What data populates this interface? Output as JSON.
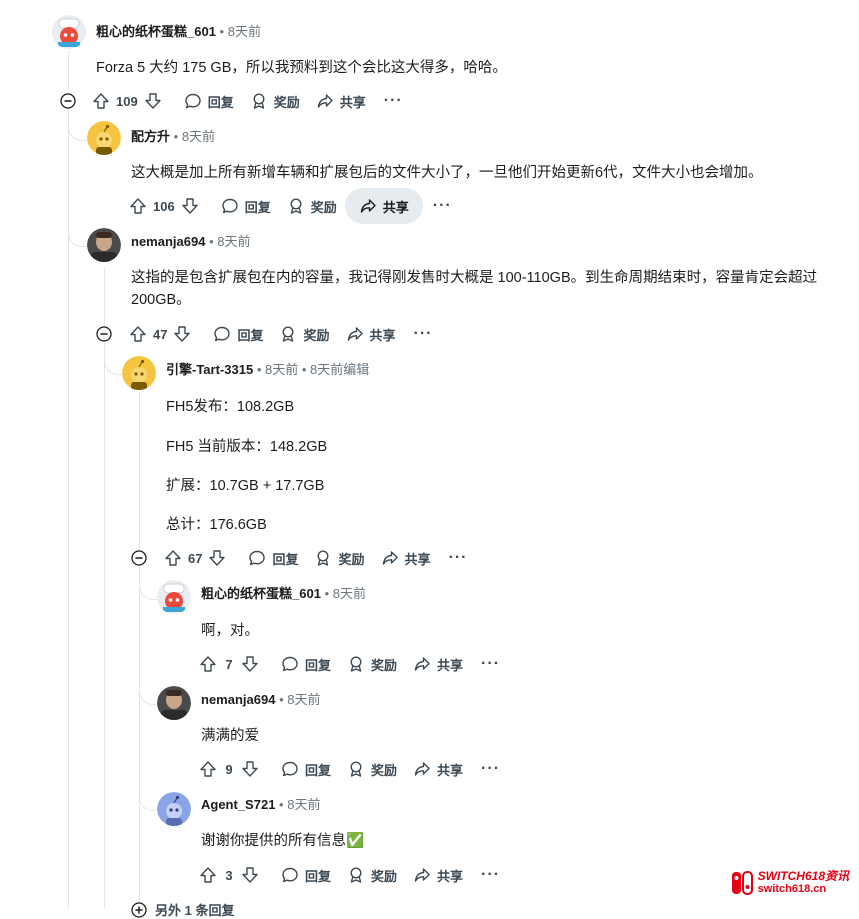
{
  "labels": {
    "reply": "回复",
    "award": "奖励",
    "share": "共享",
    "more": "···"
  },
  "comments": [
    {
      "user": "粗心的纸杯蛋糕_601",
      "time": "8天前",
      "text": "Forza 5 大约 175 GB，所以我预料到这个会比这大得多，哈哈。",
      "score": "109",
      "avatar": "snoo-red-chef"
    },
    {
      "user": "配方升",
      "time": "8天前",
      "text": "这大概是加上所有新增车辆和扩展包后的文件大小了，一旦他们开始更新6代，文件大小也会增加。",
      "score": "106",
      "avatar": "snoo-yellow"
    },
    {
      "user": "nemanja694",
      "time": "8天前",
      "text": "这指的是包含扩展包在内的容量，我记得刚发售时大概是 100-110GB。到生命周期结束时，容量肯定会超过 200GB。",
      "score": "47",
      "avatar": "photo-man"
    },
    {
      "user": "引擎-Tart-3315",
      "time": "8天前",
      "edited": "8天前编辑",
      "lines": [
        "FH5发布：108.2GB",
        "FH5 当前版本：148.2GB",
        "扩展：10.7GB + 17.7GB",
        "总计：176.6GB"
      ],
      "score": "67",
      "avatar": "snoo-yellow"
    },
    {
      "user": "粗心的纸杯蛋糕_601",
      "time": "8天前",
      "text": "啊，对。",
      "score": "7",
      "avatar": "snoo-red-chef"
    },
    {
      "user": "nemanja694",
      "time": "8天前",
      "text": "满满的爱",
      "score": "9",
      "avatar": "photo-man"
    },
    {
      "user": "Agent_S721",
      "time": "8天前",
      "text": "谢谢你提供的所有信息✅",
      "score": "3",
      "avatar": "snoo-blue"
    }
  ],
  "more_replies": "另外 1 条回复",
  "watermark": {
    "line1": "SWITCH618资讯",
    "line2": "switch618.cn"
  },
  "colors": {
    "accent_red": "#e60012",
    "line": "#e3e6e8",
    "text": "#1c1c1c",
    "muted": "#6b7680"
  }
}
